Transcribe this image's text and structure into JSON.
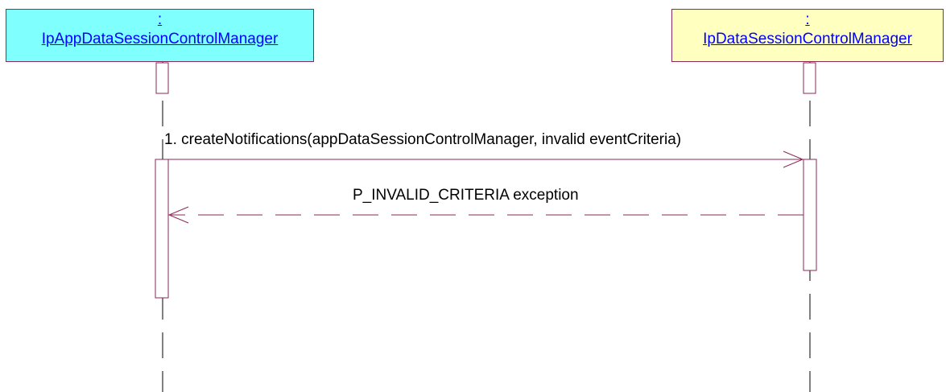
{
  "participants": {
    "left": {
      "prefix": ":",
      "name": "IpAppDataSessionControlManager",
      "fill": "#80ffff"
    },
    "right": {
      "prefix": ":",
      "name": "IpDataSessionControlManager",
      "fill": "#ffffc0"
    }
  },
  "messages": {
    "call": "1. createNotifications(appDataSessionControlManager, invalid eventCriteria)",
    "return": "P_INVALID_CRITERIA exception"
  },
  "colors": {
    "line": "#8a2a5a",
    "lifeline": "#000000",
    "participant_text": "#0000ff"
  }
}
